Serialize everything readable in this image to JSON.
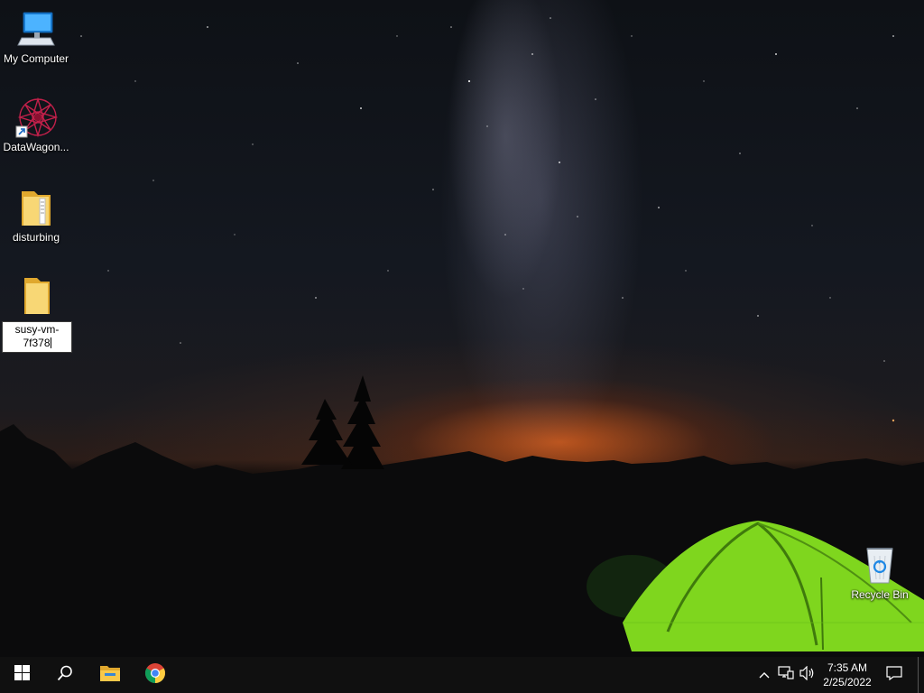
{
  "desktop": {
    "icons": [
      {
        "label": "My Computer",
        "icon": "computer-icon"
      },
      {
        "label": "DataWagon...",
        "icon": "datawagon-icon"
      },
      {
        "label": "disturbing",
        "icon": "folder-icon"
      },
      {
        "label": "susy-vm-",
        "label_line2": "7f378",
        "icon": "folder-icon",
        "state": "renaming"
      },
      {
        "label": "Recycle Bin",
        "icon": "recycle-bin-icon"
      }
    ]
  },
  "taskbar": {
    "start": {
      "icon": "windows-logo-icon"
    },
    "search": {
      "icon": "search-icon"
    },
    "pinned": [
      {
        "icon": "file-explorer-icon",
        "app": "File Explorer"
      },
      {
        "icon": "chrome-icon",
        "app": "Google Chrome"
      }
    ],
    "tray": {
      "icons": [
        "chevron-up-icon",
        "network-icon",
        "volume-icon"
      ],
      "time": "7:35 AM",
      "date": "2/25/2022",
      "notifications_icon": "action-center-icon"
    }
  }
}
